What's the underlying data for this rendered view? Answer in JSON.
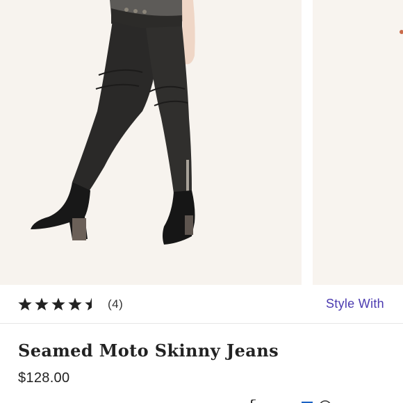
{
  "product": {
    "rating_value": 4.5,
    "rating_max": 5,
    "review_count": "(4)",
    "style_with_label": "Style With",
    "title": "Seamed Moto Skinny Jeans",
    "price": "$128.00"
  },
  "icons": {
    "star": "star-icon",
    "half_star": "half-star-icon"
  },
  "colors": {
    "accent": "#4b3ab0",
    "text": "#222222",
    "photo_background": "#f7f3ee"
  }
}
